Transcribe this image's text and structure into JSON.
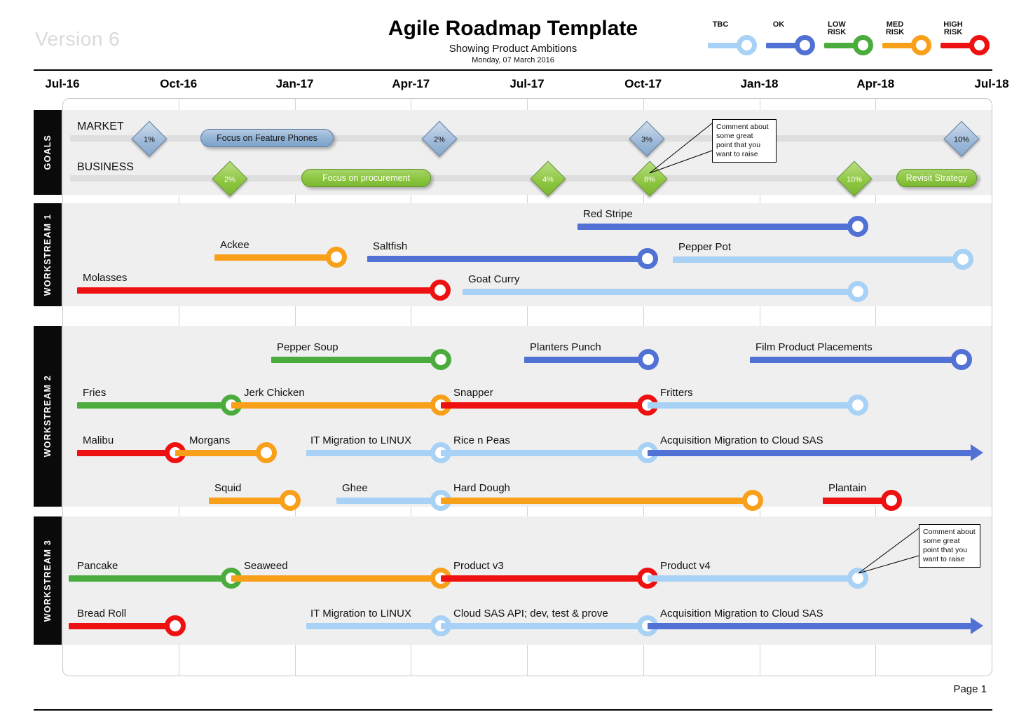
{
  "header": {
    "version": "Version 6",
    "title": "Agile Roadmap Template",
    "subtitle": "Showing Product Ambitions",
    "date": "Monday, 07 March 2016",
    "page": "Page 1"
  },
  "legend": {
    "items": [
      {
        "label": "TBC",
        "color": "#a8d2f5"
      },
      {
        "label": "OK",
        "color": "#5271d4"
      },
      {
        "label": "LOW\nRISK",
        "color": "#4bac3e"
      },
      {
        "label": "MED\nRISK",
        "color": "#f9a01b"
      },
      {
        "label": "HIGH\nRISK",
        "color": "#ee1111"
      }
    ]
  },
  "palette": {
    "tbc": "#a8d2f5",
    "ok": "#5271d4",
    "low": "#4bac3e",
    "med": "#f9a01b",
    "high": "#ee1111",
    "band": "#efefef",
    "goalbar": "#dedede",
    "lane_label_bg": "#0a0a0a"
  },
  "axis": {
    "ticks": [
      "Jul-16",
      "Oct-16",
      "Jan-17",
      "Apr-17",
      "Jul-17",
      "Oct-17",
      "Jan-18",
      "Apr-18",
      "Jul-18"
    ]
  },
  "lanes": [
    {
      "label": "GOALS"
    },
    {
      "label": "WORKSTREAM 1"
    },
    {
      "label": "WORKSTREAM 2"
    },
    {
      "label": "WORKSTREAM 3"
    }
  ],
  "goals": {
    "rows": [
      {
        "name": "MARKET",
        "milestones": [
          "1%",
          "2%",
          "3%",
          "10%"
        ],
        "pill": "Focus on Feature Phones"
      },
      {
        "name": "BUSINESS",
        "milestones": [
          "2%",
          "4%",
          "8%",
          "10%"
        ],
        "pill": "Focus on procurement",
        "pill2": "Revisit Strategy"
      }
    ]
  },
  "callouts": [
    {
      "text": "Comment about\nsome great\npoint that you\nwant to raise"
    },
    {
      "text": "Comment about\nsome great\npoint that you\nwant to raise"
    }
  ],
  "chart_data": {
    "type": "table",
    "title": "Agile Roadmap Template",
    "xlabel": "",
    "ylabel": "",
    "axis_ticks": [
      "Jul-16",
      "Oct-16",
      "Jan-17",
      "Apr-17",
      "Jul-17",
      "Oct-17",
      "Jan-18",
      "Apr-18",
      "Jul-18"
    ],
    "tasks": [
      {
        "lane": "WORKSTREAM 1",
        "label": "Red Stripe",
        "risk": "ok",
        "start": "Oct-17",
        "end": "Jan-18"
      },
      {
        "lane": "WORKSTREAM 1",
        "label": "Ackee",
        "risk": "med",
        "start": "Oct-16",
        "end": "Mar-17"
      },
      {
        "lane": "WORKSTREAM 1",
        "label": "Saltfish",
        "risk": "ok",
        "start": "Apr-17",
        "end": "Oct-17"
      },
      {
        "lane": "WORKSTREAM 1",
        "label": "Pepper Pot",
        "risk": "tbc",
        "start": "Nov-17",
        "end": "Jul-18"
      },
      {
        "lane": "WORKSTREAM 1",
        "label": "Molasses",
        "risk": "high",
        "start": "Jul-16",
        "end": "Apr-17"
      },
      {
        "lane": "WORKSTREAM 1",
        "label": "Goat Curry",
        "risk": "tbc",
        "start": "Jun-17",
        "end": "Apr-18"
      },
      {
        "lane": "WORKSTREAM 2",
        "label": "Pepper Soup",
        "risk": "low",
        "start": "Jan-17",
        "end": "Jun-17"
      },
      {
        "lane": "WORKSTREAM 2",
        "label": "Planters Punch",
        "risk": "ok",
        "start": "Jul-17",
        "end": "Oct-17"
      },
      {
        "lane": "WORKSTREAM 2",
        "label": "Film Product Placements",
        "risk": "ok",
        "start": "Jan-18",
        "end": "Jul-18"
      },
      {
        "lane": "WORKSTREAM 2",
        "label": "Fries",
        "risk": "low",
        "start": "Jul-16",
        "end": "Nov-16"
      },
      {
        "lane": "WORKSTREAM 2",
        "label": "Jerk Chicken",
        "risk": "med",
        "start": "Nov-16",
        "end": "Apr-17"
      },
      {
        "lane": "WORKSTREAM 2",
        "label": "Snapper",
        "risk": "high",
        "start": "Apr-17",
        "end": "Oct-17"
      },
      {
        "lane": "WORKSTREAM 2",
        "label": "Fritters",
        "risk": "tbc",
        "start": "Oct-17",
        "end": "Apr-18"
      },
      {
        "lane": "WORKSTREAM 2",
        "label": "Malibu",
        "risk": "high",
        "start": "Jul-16",
        "end": "Oct-16"
      },
      {
        "lane": "WORKSTREAM 2",
        "label": "Morgans",
        "risk": "med",
        "start": "Oct-16",
        "end": "Dec-16"
      },
      {
        "lane": "WORKSTREAM 2",
        "label": "IT Migration to LINUX",
        "risk": "tbc",
        "start": "Jan-17",
        "end": "Apr-17"
      },
      {
        "lane": "WORKSTREAM 2",
        "label": "Rice n Peas",
        "risk": "tbc",
        "start": "Apr-17",
        "end": "Oct-17"
      },
      {
        "lane": "WORKSTREAM 2",
        "label": "Acquisition Migration to Cloud SAS",
        "risk": "ok",
        "start": "Oct-17",
        "end": "Jul-18",
        "arrow": true
      },
      {
        "lane": "WORKSTREAM 2",
        "label": "Squid",
        "risk": "med",
        "start": "Oct-16",
        "end": "Dec-16"
      },
      {
        "lane": "WORKSTREAM 2",
        "label": "Ghee",
        "risk": "tbc",
        "start": "Feb-17",
        "end": "Apr-17"
      },
      {
        "lane": "WORKSTREAM 2",
        "label": "Hard Dough",
        "risk": "med",
        "start": "Apr-17",
        "end": "Jan-18"
      },
      {
        "lane": "WORKSTREAM 2",
        "label": "Plantain",
        "risk": "high",
        "start": "Mar-18",
        "end": "Apr-18"
      },
      {
        "lane": "WORKSTREAM 3",
        "label": "Pancake",
        "risk": "low",
        "start": "Jul-16",
        "end": "Nov-16"
      },
      {
        "lane": "WORKSTREAM 3",
        "label": "Seaweed",
        "risk": "med",
        "start": "Nov-16",
        "end": "Apr-17"
      },
      {
        "lane": "WORKSTREAM 3",
        "label": "Product v3",
        "risk": "high",
        "start": "Apr-17",
        "end": "Oct-17"
      },
      {
        "lane": "WORKSTREAM 3",
        "label": "Product v4",
        "risk": "tbc",
        "start": "Oct-17",
        "end": "Apr-18"
      },
      {
        "lane": "WORKSTREAM 3",
        "label": "Bread Roll",
        "risk": "high",
        "start": "Jul-16",
        "end": "Sep-16"
      },
      {
        "lane": "WORKSTREAM 3",
        "label": "IT Migration to LINUX",
        "risk": "tbc",
        "start": "Jan-17",
        "end": "Apr-17"
      },
      {
        "lane": "WORKSTREAM 3",
        "label": "Cloud SAS API; dev, test & prove",
        "risk": "tbc",
        "start": "Apr-17",
        "end": "Oct-17"
      },
      {
        "lane": "WORKSTREAM 3",
        "label": "Acquisition Migration to Cloud SAS",
        "risk": "ok",
        "start": "Oct-17",
        "end": "Jul-18",
        "arrow": true
      }
    ],
    "goal_milestones": [
      {
        "row": "MARKET",
        "value": "1%",
        "tick": "Jul-16/Oct-16"
      },
      {
        "row": "MARKET",
        "value": "2%",
        "tick": "Apr-17"
      },
      {
        "row": "MARKET",
        "value": "3%",
        "tick": "Oct-17"
      },
      {
        "row": "MARKET",
        "value": "10%",
        "tick": "Jul-18"
      },
      {
        "row": "BUSINESS",
        "value": "2%",
        "tick": "Oct-16"
      },
      {
        "row": "BUSINESS",
        "value": "4%",
        "tick": "Jul-17"
      },
      {
        "row": "BUSINESS",
        "value": "8%",
        "tick": "Oct-17"
      },
      {
        "row": "BUSINESS",
        "value": "10%",
        "tick": "Apr-18"
      }
    ]
  }
}
